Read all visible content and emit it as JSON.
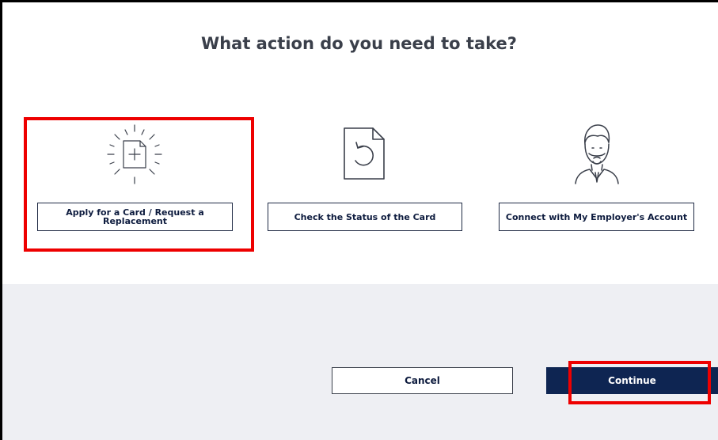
{
  "page": {
    "title": "What action do you need to take?"
  },
  "options": [
    {
      "label": "Apply for a Card / Request a Replacement",
      "icon": "new-document-icon",
      "selected": true
    },
    {
      "label": "Check the Status of the Card",
      "icon": "document-refresh-icon",
      "selected": false
    },
    {
      "label": "Connect with My Employer's Account",
      "icon": "employer-person-icon",
      "selected": false
    }
  ],
  "footer": {
    "cancel_label": "Cancel",
    "continue_label": "Continue"
  },
  "colors": {
    "primary_navy": "#0e2552",
    "highlight_red": "#ee0000",
    "footer_background": "#eeeff3"
  }
}
